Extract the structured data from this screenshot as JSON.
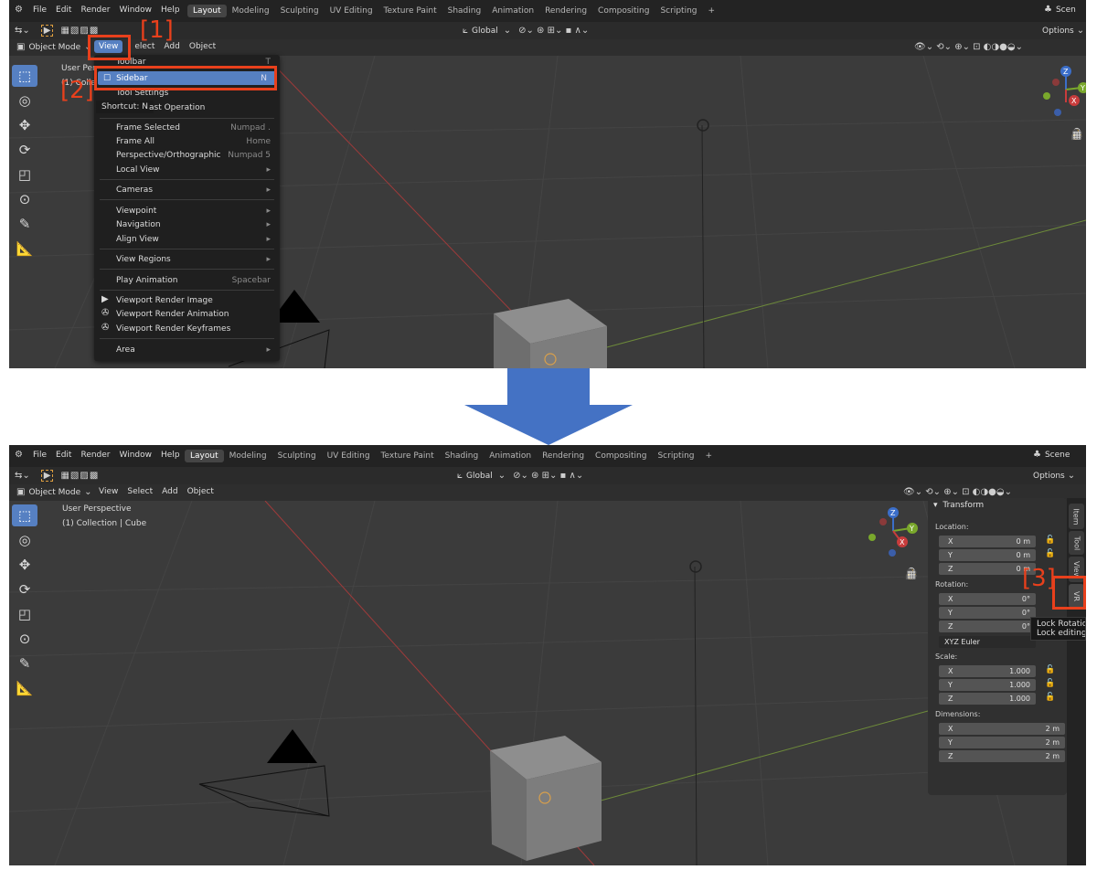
{
  "top_menus": [
    "File",
    "Edit",
    "Render",
    "Window",
    "Help"
  ],
  "workspace_tabs": [
    "Layout",
    "Modeling",
    "Sculpting",
    "UV Editing",
    "Texture Paint",
    "Shading",
    "Animation",
    "Rendering",
    "Compositing",
    "Scripting"
  ],
  "active_tab": "Layout",
  "add_tab_symbol": "+",
  "scene_label": "Scene",
  "scene_label_cut": "Scen",
  "options_label": "Options",
  "transform_orientation": "Global",
  "mode_label": "Object Mode",
  "view_menu": [
    "View",
    "Select",
    "Add",
    "Object"
  ],
  "select_partial": "elect",
  "viewport_info": {
    "perspective": "User Perspective",
    "collection": "(1) Collection | Cube",
    "collection_partial": "(1) Colle"
  },
  "step_labels": [
    "[1]",
    "[2]",
    "[3]"
  ],
  "view_dropdown": {
    "toolbar_partial": "Toolbar",
    "toolbar_shortcut": "T",
    "sidebar": "Sidebar",
    "sidebar_shortcut": "N",
    "tool_settings": "Tool Settings",
    "tooltip_shortcut": "Shortcut: N",
    "adjust_last_partial": "ast Operation",
    "items": [
      {
        "label": "Frame Selected",
        "shortcut": "Numpad ."
      },
      {
        "label": "Frame All",
        "shortcut": "Home"
      },
      {
        "label": "Perspective/Orthographic",
        "shortcut": "Numpad 5"
      },
      {
        "label": "Local View",
        "shortcut": "▸"
      },
      {
        "label": "Cameras",
        "shortcut": "▸"
      },
      {
        "label": "Viewpoint",
        "shortcut": "▸"
      },
      {
        "label": "Navigation",
        "shortcut": "▸"
      },
      {
        "label": "Align View",
        "shortcut": "▸"
      },
      {
        "label": "View Regions",
        "shortcut": "▸"
      },
      {
        "label": "Play Animation",
        "shortcut": "Spacebar"
      },
      {
        "label": "Viewport Render Image",
        "shortcut": ""
      },
      {
        "label": "Viewport Render Animation",
        "shortcut": ""
      },
      {
        "label": "Viewport Render Keyframes",
        "shortcut": ""
      },
      {
        "label": "Area",
        "shortcut": "▸"
      }
    ]
  },
  "sidebar_panel": {
    "title": "Transform",
    "location_label": "Location:",
    "location": [
      {
        "axis": "X",
        "value": "0 m"
      },
      {
        "axis": "Y",
        "value": "0 m"
      },
      {
        "axis": "Z",
        "value": "0 m"
      }
    ],
    "rotation_label": "Rotation:",
    "rotation": [
      {
        "axis": "X",
        "value": "0°"
      },
      {
        "axis": "Y",
        "value": "0°"
      },
      {
        "axis": "Z",
        "value": "0°"
      }
    ],
    "rotation_mode": "XYZ Euler",
    "scale_label": "Scale:",
    "scale": [
      {
        "axis": "X",
        "value": "1.000"
      },
      {
        "axis": "Y",
        "value": "1.000"
      },
      {
        "axis": "Z",
        "value": "1.000"
      }
    ],
    "dimensions_label": "Dimensions:",
    "dimensions": [
      {
        "axis": "X",
        "value": "2 m"
      },
      {
        "axis": "Y",
        "value": "2 m"
      },
      {
        "axis": "Z",
        "value": "2 m"
      }
    ],
    "tabs": [
      "Item",
      "Tool",
      "View",
      "VR"
    ],
    "tooltip_line1": "Lock Rotation",
    "tooltip_line2": "Lock editing o"
  },
  "axis_gizmo": {
    "x": "X",
    "y": "Y",
    "z": "Z"
  },
  "colors": {
    "accent": "#5680c2",
    "annotation": "#e8401c",
    "arrow": "#4472c4"
  }
}
